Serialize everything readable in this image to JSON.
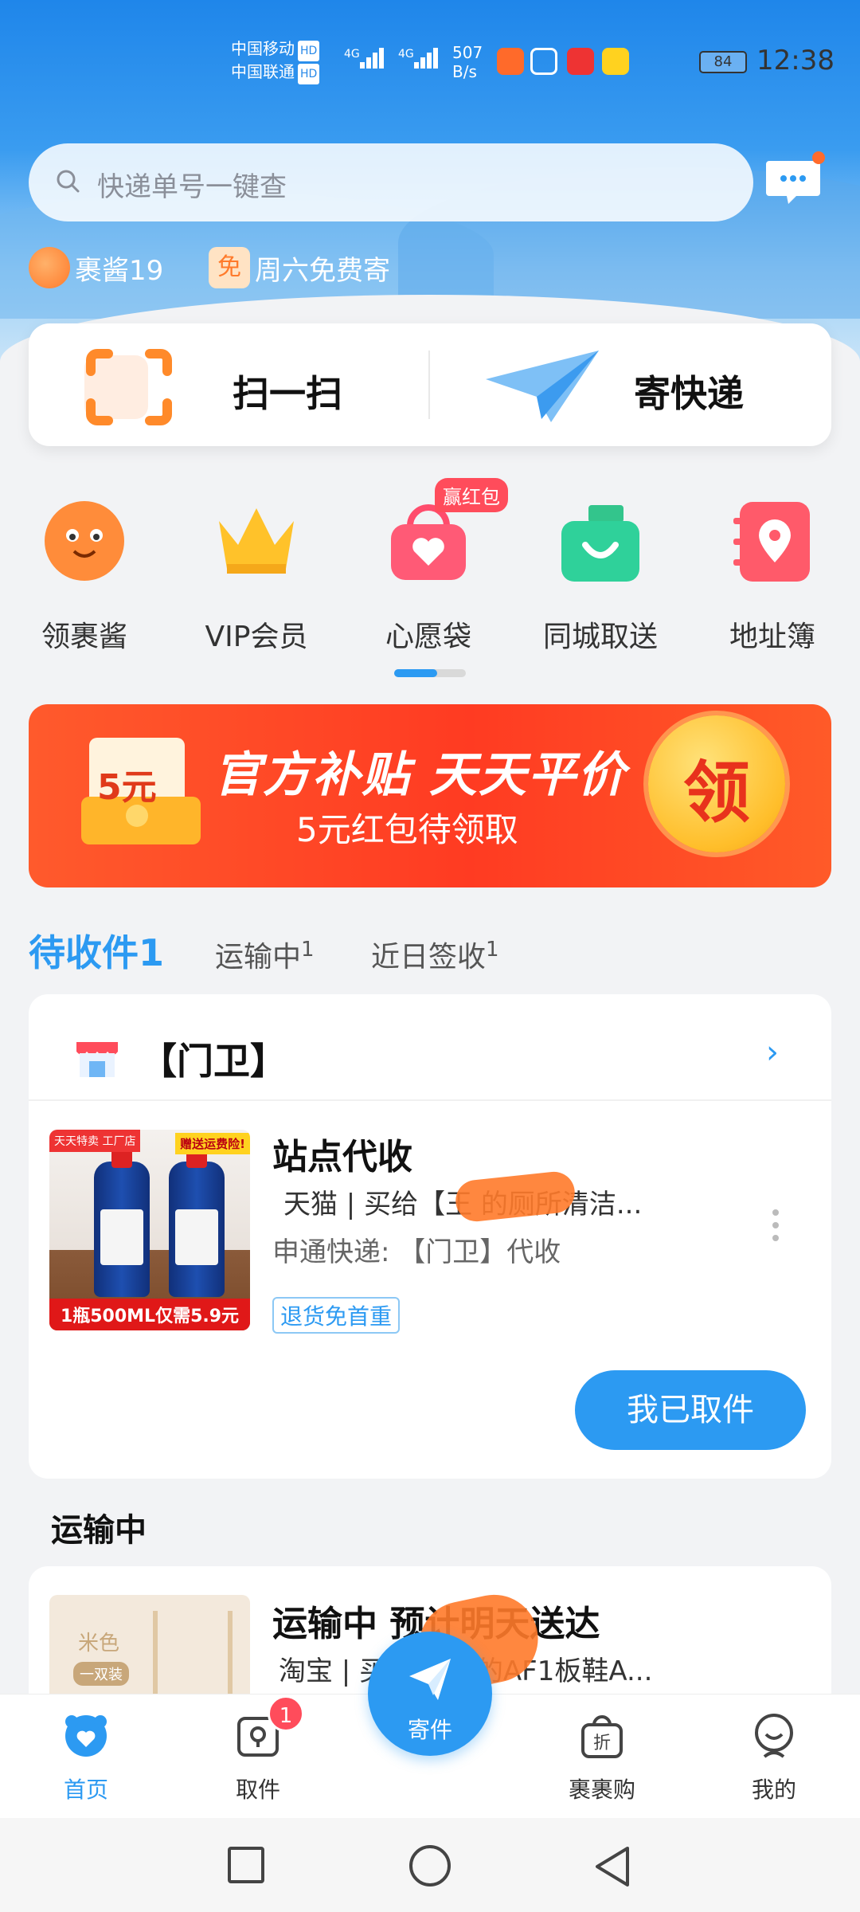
{
  "status_bar": {
    "carrier1": "中国移动",
    "carrier2": "中国联通",
    "hd": "HD",
    "net_type": "4G",
    "speed_value": "507",
    "speed_unit": "B/s",
    "battery": "84",
    "time": "12:38"
  },
  "search": {
    "placeholder": "快递单号一键查"
  },
  "tags": {
    "mascot": "裹酱19",
    "free_icon": "免",
    "free": "周六免费寄"
  },
  "actions": {
    "scan": "扫一扫",
    "send": "寄快递"
  },
  "grid": {
    "items": [
      {
        "label": "领裹酱",
        "icon": "mascot-face-icon"
      },
      {
        "label": "VIP会员",
        "icon": "crown-icon"
      },
      {
        "label": "心愿袋",
        "icon": "heart-bag-icon"
      },
      {
        "label": "同城取送",
        "icon": "shopping-bag-icon"
      },
      {
        "label": "地址簿",
        "icon": "address-book-icon"
      }
    ],
    "badge": "赢红包",
    "page_progress": 0.6
  },
  "banner": {
    "amount": "5元",
    "title": "官方补贴 天天平价",
    "subtitle": "5元红包待领取",
    "coin_text": "领"
  },
  "tabs": [
    {
      "label": "待收件",
      "count": "1"
    },
    {
      "label": "运输中",
      "count": "1"
    },
    {
      "label": "近日签收",
      "count": "1"
    }
  ],
  "pending_card": {
    "station": "【门卫】",
    "status": "站点代收",
    "desc": "天猫 | 买给【王  的厕所清洁...",
    "carrier": "申通快递: 【门卫】代收",
    "tag": "退货免首重",
    "button": "我已取件",
    "product": {
      "badge_left": "天天特卖 工厂店",
      "badge_right": "赠送运费险!",
      "bottom": "1瓶500ML仅需5.9元"
    }
  },
  "transit_section": {
    "title": "运输中"
  },
  "transit_card": {
    "status": "运输中 预计明天送达",
    "desc": "淘宝 | 买给【王   的AF1板鞋A...",
    "product": {
      "label1": "米色",
      "label2": "一双装"
    }
  },
  "bottom_nav": {
    "items": [
      {
        "label": "首页",
        "icon": "home-icon"
      },
      {
        "label": "取件",
        "icon": "pickup-icon"
      },
      {
        "label": "寄件",
        "icon": "send-plane-icon"
      },
      {
        "label": "裹裹购",
        "icon": "discount-bag-icon"
      },
      {
        "label": "我的",
        "icon": "profile-icon"
      }
    ],
    "pickup_badge": "1"
  },
  "colors": {
    "accent": "#2c9af2",
    "orange": "#ff7a2a",
    "red": "#ff3b22"
  }
}
